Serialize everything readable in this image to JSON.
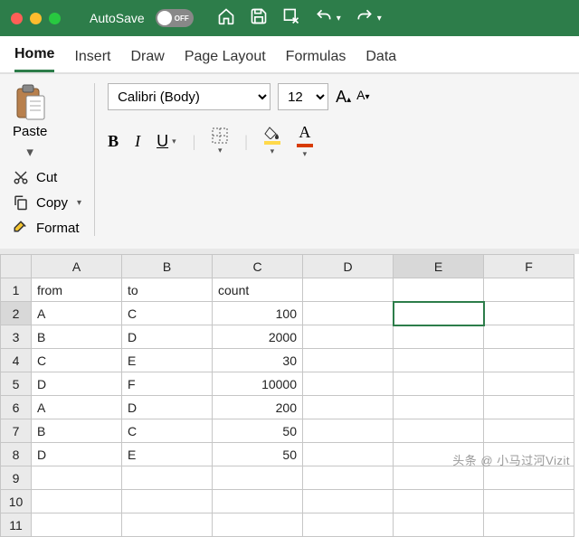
{
  "titlebar": {
    "autosave_label": "AutoSave",
    "autosave_state": "OFF"
  },
  "tabs": [
    "Home",
    "Insert",
    "Draw",
    "Page Layout",
    "Formulas",
    "Data"
  ],
  "active_tab": 0,
  "clipboard": {
    "paste": "Paste",
    "cut": "Cut",
    "copy": "Copy",
    "format": "Format"
  },
  "font": {
    "name": "Calibri (Body)",
    "size": "12",
    "increase": "A",
    "decrease": "A"
  },
  "fmt": {
    "bold": "B",
    "italic": "I",
    "underline": "U",
    "fill_color": "#ffd94a",
    "font_color": "#d83b01"
  },
  "columns": [
    "A",
    "B",
    "C",
    "D",
    "E",
    "F"
  ],
  "rows": [
    "1",
    "2",
    "3",
    "4",
    "5",
    "6",
    "7",
    "8",
    "9",
    "10",
    "11"
  ],
  "chart_data": {
    "type": "table",
    "headers": [
      "from",
      "to",
      "count"
    ],
    "records": [
      {
        "from": "A",
        "to": "C",
        "count": 100
      },
      {
        "from": "B",
        "to": "D",
        "count": 2000
      },
      {
        "from": "C",
        "to": "E",
        "count": 30
      },
      {
        "from": "D",
        "to": "F",
        "count": 10000
      },
      {
        "from": "A",
        "to": "D",
        "count": 200
      },
      {
        "from": "B",
        "to": "C",
        "count": 50
      },
      {
        "from": "D",
        "to": "E",
        "count": 50
      }
    ]
  },
  "active_cell": "E2",
  "watermark": "头条 @ 小马过河Vizit"
}
